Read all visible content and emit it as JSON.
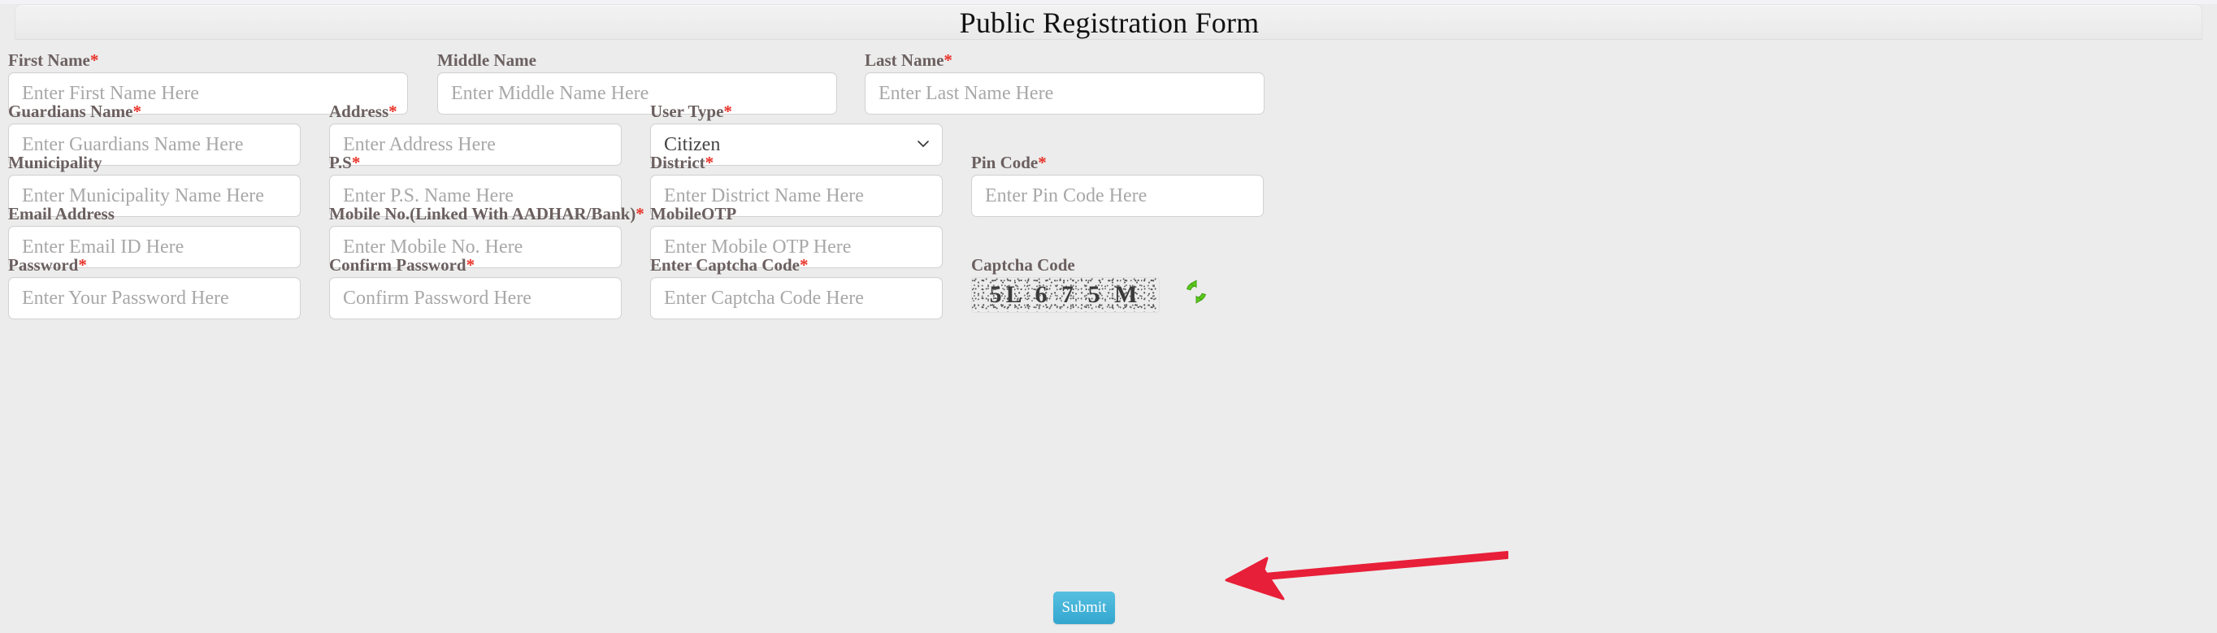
{
  "page": {
    "title": "Public Registration Form",
    "background_color": "#ececec",
    "label_color": "#6b5f5f",
    "required_marker": "*",
    "required_color": "#e8332a"
  },
  "form": {
    "rows": [
      {
        "fields": [
          {
            "name": "first-name",
            "label": "First Name",
            "required": true,
            "placeholder": "Enter First Name Here",
            "value": "",
            "type": "text"
          },
          {
            "name": "middle-name",
            "label": "Middle Name",
            "required": false,
            "placeholder": "Enter Middle Name Here",
            "value": "",
            "type": "text"
          },
          {
            "name": "last-name",
            "label": "Last Name",
            "required": true,
            "placeholder": "Enter Last Name Here",
            "value": "",
            "type": "text"
          }
        ]
      },
      {
        "fields": [
          {
            "name": "guardians-name",
            "label": "Guardians Name",
            "required": true,
            "placeholder": "Enter Guardians Name Here",
            "value": "",
            "type": "text"
          },
          {
            "name": "address",
            "label": "Address",
            "required": true,
            "placeholder": "Enter Address Here",
            "value": "",
            "type": "text"
          },
          {
            "name": "user-type",
            "label": "User Type",
            "required": true,
            "placeholder": "",
            "value": "Citizen",
            "type": "select",
            "options": [
              "Citizen"
            ]
          }
        ]
      },
      {
        "fields": [
          {
            "name": "municipality",
            "label": "Municipality",
            "required": false,
            "placeholder": "Enter Municipality Name Here",
            "value": "",
            "type": "text"
          },
          {
            "name": "police-station",
            "label": "P.S",
            "required": true,
            "placeholder": "Enter P.S. Name Here",
            "value": "",
            "type": "text"
          },
          {
            "name": "district",
            "label": "District",
            "required": true,
            "placeholder": "Enter District Name Here",
            "value": "",
            "type": "text"
          },
          {
            "name": "pin-code",
            "label": "Pin Code",
            "required": true,
            "placeholder": "Enter Pin Code Here",
            "value": "",
            "type": "text"
          }
        ]
      },
      {
        "fields": [
          {
            "name": "email-address",
            "label": "Email Address",
            "required": false,
            "placeholder": "Enter Email ID Here",
            "value": "",
            "type": "text"
          },
          {
            "name": "mobile-no",
            "label": "Mobile No.(Linked With AADHAR/Bank)",
            "required": true,
            "placeholder": "Enter Mobile No. Here",
            "value": "",
            "type": "text"
          },
          {
            "name": "mobile-otp",
            "label": "MobileOTP",
            "required": false,
            "placeholder": "Enter Mobile OTP Here",
            "value": "",
            "type": "text"
          }
        ]
      },
      {
        "fields": [
          {
            "name": "password",
            "label": "Password",
            "required": true,
            "placeholder": "Enter Your Password Here",
            "value": "",
            "type": "password"
          },
          {
            "name": "confirm-password",
            "label": "Confirm Password",
            "required": true,
            "placeholder": "Confirm Password Here",
            "value": "",
            "type": "password"
          },
          {
            "name": "enter-captcha-code",
            "label": "Enter Captcha Code",
            "required": true,
            "placeholder": "Enter Captcha Code Here",
            "value": "",
            "type": "text"
          }
        ]
      }
    ],
    "captcha": {
      "label": "Captcha Code",
      "code": "5L 6 7 5 M",
      "refresh_icon": "refresh-icon",
      "refresh_icon_color": "#57c91b"
    },
    "submit": {
      "label": "Submit",
      "color": "#45b3d8"
    }
  },
  "annotation": {
    "arrow": {
      "name": "red-arrow-annotation",
      "color": "#e81f38",
      "points_to": "submit-button",
      "direction": "left"
    }
  }
}
